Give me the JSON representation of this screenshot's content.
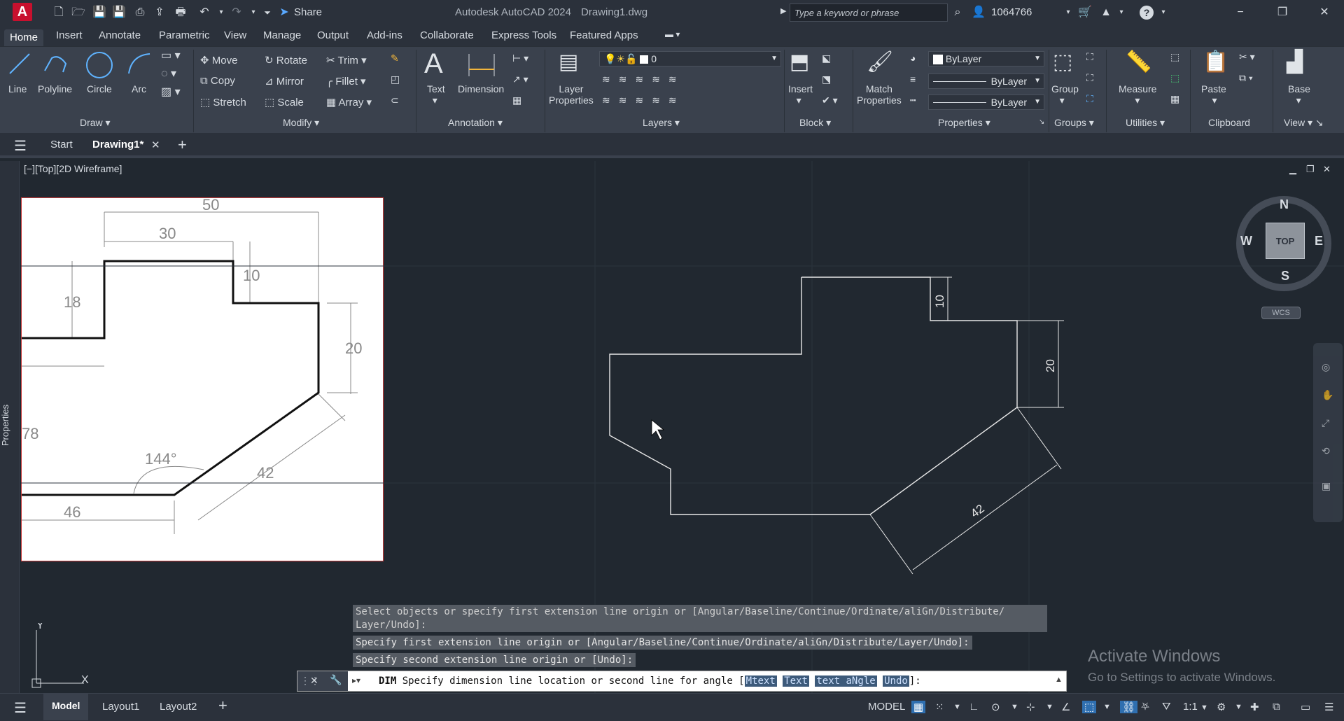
{
  "titlebar": {
    "app_badge": "A",
    "share_label": "Share",
    "app_title": "Autodesk AutoCAD 2024",
    "file_name": "Drawing1.dwg",
    "search_placeholder": "Type a keyword or phrase",
    "user_id": "1064766",
    "help_label": "?"
  },
  "ribbon_tabs": [
    "Home",
    "Insert",
    "Annotate",
    "Parametric",
    "View",
    "Manage",
    "Output",
    "Add-ins",
    "Collaborate",
    "Express Tools",
    "Featured Apps"
  ],
  "ribbon": {
    "draw": {
      "title": "Draw",
      "line": "Line",
      "polyline": "Polyline",
      "circle": "Circle",
      "arc": "Arc"
    },
    "modify": {
      "title": "Modify",
      "move": "Move",
      "rotate": "Rotate",
      "trim": "Trim",
      "copy": "Copy",
      "mirror": "Mirror",
      "fillet": "Fillet",
      "stretch": "Stretch",
      "scale": "Scale",
      "array": "Array"
    },
    "annotation": {
      "title": "Annotation",
      "text": "Text",
      "dimension": "Dimension"
    },
    "layers": {
      "title": "Layers",
      "layer_properties_1": "Layer",
      "layer_properties_2": "Properties",
      "current_layer": "0"
    },
    "block": {
      "title": "Block",
      "insert": "Insert"
    },
    "properties": {
      "title": "Properties",
      "match_1": "Match",
      "match_2": "Properties",
      "color": "ByLayer",
      "linetype": "ByLayer",
      "lineweight": "ByLayer"
    },
    "groups": {
      "title": "Groups",
      "group": "Group"
    },
    "utilities": {
      "title": "Utilities",
      "measure": "Measure"
    },
    "clipboard": {
      "title": "Clipboard",
      "paste": "Paste"
    },
    "view": {
      "title": "View",
      "base": "Base"
    }
  },
  "doc_tabs": {
    "start": "Start",
    "drawing": "Drawing1*"
  },
  "viewport": {
    "label": "[−][Top][2D Wireframe]",
    "side_panel": "Properties",
    "compass": {
      "n": "N",
      "s": "S",
      "e": "E",
      "w": "W",
      "top": "TOP",
      "wcs": "WCS"
    },
    "ucs": {
      "x": "X",
      "y": "Y"
    }
  },
  "reference": {
    "d50": "50",
    "d30": "30",
    "d10": "10",
    "d18": "18",
    "d20": "20",
    "d78": "78",
    "d144": "144°",
    "d42": "42",
    "d46": "46"
  },
  "drawing_dims": {
    "d10": "10",
    "d20": "20",
    "d42": "42"
  },
  "command": {
    "history": [
      "Select objects or specify first extension line origin or [Angular/Baseline/Continue/Ordinate/aliGn/Distribute/",
      "Layer/Undo]:",
      "Specify first extension line origin or [Angular/Baseline/Continue/Ordinate/aliGn/Distribute/Layer/Undo]:",
      "Specify second extension line origin or [Undo]:"
    ],
    "prompt_cmd": "DIM",
    "prompt_text": "Specify dimension line location or second line for angle [",
    "options": [
      "Mtext",
      "Text",
      "text aNgle",
      "Undo"
    ],
    "prompt_end": "]:"
  },
  "watermark": {
    "title": "Activate Windows",
    "subtitle": "Go to Settings to activate Windows."
  },
  "status": {
    "model_tab": "Model",
    "layout1": "Layout1",
    "layout2": "Layout2",
    "model_btn": "MODEL",
    "scale": "1:1"
  }
}
